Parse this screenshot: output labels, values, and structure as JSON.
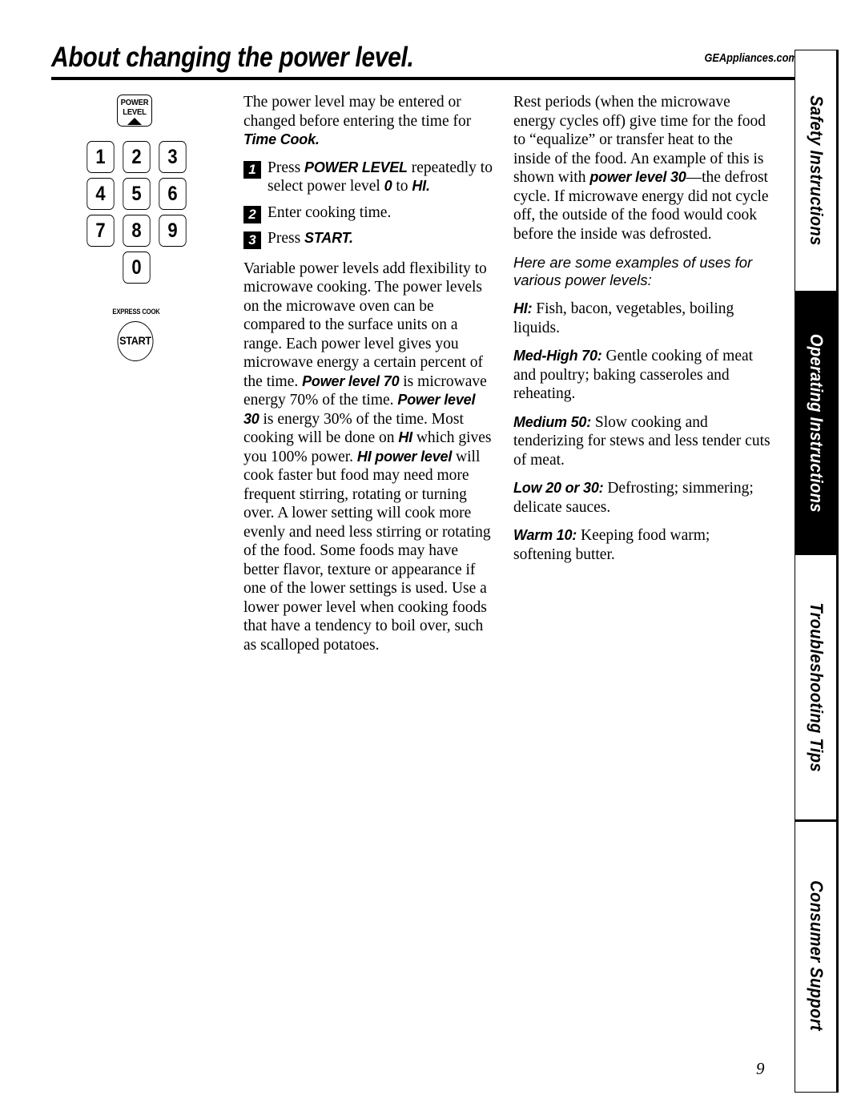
{
  "header": {
    "title": "About changing the power level.",
    "site_url": "GEAppliances.com"
  },
  "keypad": {
    "power_level_label_line1": "POWER",
    "power_level_label_line2": "LEVEL",
    "keys": [
      "1",
      "2",
      "3",
      "4",
      "5",
      "6",
      "7",
      "8",
      "9",
      "0"
    ],
    "express_cook_label": "EXPRESS COOK",
    "start_label": "START"
  },
  "left_column": {
    "intro": {
      "text_1": "The power level may be entered or changed before entering the time for ",
      "emph_1": "Time Cook."
    },
    "steps": [
      {
        "number": "1",
        "text_1": "Press ",
        "emph_1": "POWER LEVEL",
        "text_2": " repeatedly to select power level ",
        "emph_2": "0",
        "text_3": " to ",
        "emph_3": "HI."
      },
      {
        "number": "2",
        "text_1": "Enter cooking time."
      },
      {
        "number": "3",
        "text_1": "Press ",
        "emph_1": "START."
      }
    ],
    "variable_paragraph": {
      "t1": "Variable power levels add flexibility to microwave cooking. The power levels on the microwave oven can be compared to the surface units on a range. Each power level gives you microwave energy a certain percent of the time. ",
      "e1": "Power level 70",
      "t2": " is microwave energy 70% of the time. ",
      "e2": "Power level 30",
      "t3": " is energy 30% of the time. Most cooking will be done on ",
      "e3": "HI",
      "t4": " which gives you 100% power. ",
      "e4": "HI power level",
      "t5": " will cook faster but food may need more frequent stirring, rotating or turning over. A lower setting will cook more evenly and need less stirring or rotating of the food. Some foods may have better flavor, texture or appearance if one of the lower settings is used. Use a lower power level when cooking foods that have a tendency to boil over, such as scalloped potatoes."
    }
  },
  "right_column": {
    "rest_periods_paragraph": {
      "t1": "Rest periods (when the microwave energy cycles off) give time for the food to “equalize” or transfer heat to the inside of the food. An example of this is shown with ",
      "e1": "power level 30",
      "t2": "—the defrost cycle. If microwave energy did not cycle off, the outside of the food would cook before the inside was defrosted."
    },
    "examples_heading": "Here are some examples of uses for various power levels:",
    "levels": [
      {
        "name": "HI:",
        "description": "  Fish, bacon, vegetables, boiling liquids."
      },
      {
        "name": "Med-High 70:",
        "description": "  Gentle cooking of meat and poultry; baking casseroles and reheating."
      },
      {
        "name": "Medium 50:",
        "description": "  Slow cooking and tenderizing for stews and less tender cuts of meat."
      },
      {
        "name": "Low 20 or 30:",
        "description": "  Defrosting; simmering; delicate sauces."
      },
      {
        "name": "Warm 10:",
        "description": "  Keeping food warm; softening butter."
      }
    ]
  },
  "tabs": [
    {
      "label": "Safety Instructions",
      "active": false
    },
    {
      "label": "Operating Instructions",
      "active": true
    },
    {
      "label": "Troubleshooting Tips",
      "active": false
    },
    {
      "label": "Consumer Support",
      "active": false
    }
  ],
  "page_number": "9",
  "colors": {
    "ink": "#000000",
    "paper": "#ffffff"
  }
}
